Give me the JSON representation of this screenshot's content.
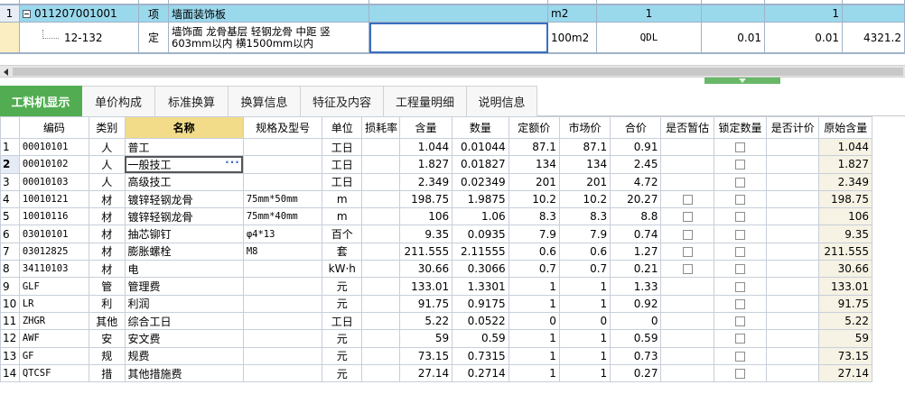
{
  "top_grid": {
    "rows": [
      {
        "rownum": "1",
        "code": "011207001001",
        "category": "项",
        "name": "墙面装饰板",
        "unit": "m2",
        "quantity_expr": "1",
        "quantity": "1"
      },
      {
        "rownum": "",
        "code": "12-132",
        "category": "定",
        "name": "墙饰面 龙骨基层 轻钢龙骨 中距 竖603mm以内 横1500mm以内",
        "unit": "100m2",
        "quantity_expr": "QDL",
        "qty_a": "0.01",
        "qty_b": "0.01",
        "price": "4321.2"
      }
    ]
  },
  "tabs": [
    {
      "label": "工料机显示",
      "active": true
    },
    {
      "label": "单价构成",
      "active": false
    },
    {
      "label": "标准换算",
      "active": false
    },
    {
      "label": "换算信息",
      "active": false
    },
    {
      "label": "特征及内容",
      "active": false
    },
    {
      "label": "工程量明细",
      "active": false
    },
    {
      "label": "说明信息",
      "active": false
    }
  ],
  "material_table": {
    "columns": [
      "",
      "编码",
      "类别",
      "名称",
      "规格及型号",
      "单位",
      "损耗率",
      "含量",
      "数量",
      "定额价",
      "市场价",
      "合价",
      "是否暂估",
      "锁定数量",
      "是否计价",
      "原始含量"
    ],
    "sorted_column": 3,
    "current_row": 1,
    "rows": [
      {
        "n": "1",
        "code": "00010101",
        "cat": "人",
        "name": "普工",
        "spec": "",
        "unit": "工日",
        "loss": "",
        "content": "1.044",
        "qty": "0.01044",
        "quota": "87.1",
        "market": "87.1",
        "total": "0.91",
        "est": false,
        "lock": true,
        "orig": "1.044"
      },
      {
        "n": "2",
        "code": "00010102",
        "cat": "人",
        "name": "一般技工",
        "spec": "",
        "unit": "工日",
        "loss": "",
        "content": "1.827",
        "qty": "0.01827",
        "quota": "134",
        "market": "134",
        "total": "2.45",
        "est": false,
        "lock": true,
        "orig": "1.827"
      },
      {
        "n": "3",
        "code": "00010103",
        "cat": "人",
        "name": "高级技工",
        "spec": "",
        "unit": "工日",
        "loss": "",
        "content": "2.349",
        "qty": "0.02349",
        "quota": "201",
        "market": "201",
        "total": "4.72",
        "est": false,
        "lock": true,
        "orig": "2.349"
      },
      {
        "n": "4",
        "code": "10010121",
        "cat": "材",
        "name": "镀锌轻钢龙骨",
        "spec": "75mm*50mm",
        "unit": "m",
        "loss": "",
        "content": "198.75",
        "qty": "1.9875",
        "quota": "10.2",
        "market": "10.2",
        "total": "20.27",
        "est": true,
        "lock": true,
        "orig": "198.75"
      },
      {
        "n": "5",
        "code": "10010116",
        "cat": "材",
        "name": "镀锌轻钢龙骨",
        "spec": "75mm*40mm",
        "unit": "m",
        "loss": "",
        "content": "106",
        "qty": "1.06",
        "quota": "8.3",
        "market": "8.3",
        "total": "8.8",
        "est": true,
        "lock": true,
        "orig": "106"
      },
      {
        "n": "6",
        "code": "03010101",
        "cat": "材",
        "name": "抽芯铆钉",
        "spec": "φ4*13",
        "unit": "百个",
        "loss": "",
        "content": "9.35",
        "qty": "0.0935",
        "quota": "7.9",
        "market": "7.9",
        "total": "0.74",
        "est": true,
        "lock": true,
        "orig": "9.35"
      },
      {
        "n": "7",
        "code": "03012825",
        "cat": "材",
        "name": "膨胀螺栓",
        "spec": "M8",
        "unit": "套",
        "loss": "",
        "content": "211.555",
        "qty": "2.11555",
        "quota": "0.6",
        "market": "0.6",
        "total": "1.27",
        "est": true,
        "lock": true,
        "orig": "211.555"
      },
      {
        "n": "8",
        "code": "34110103",
        "cat": "材",
        "name": "电",
        "spec": "",
        "unit": "kW·h",
        "loss": "",
        "content": "30.66",
        "qty": "0.3066",
        "quota": "0.7",
        "market": "0.7",
        "total": "0.21",
        "est": true,
        "lock": true,
        "orig": "30.66"
      },
      {
        "n": "9",
        "code": "GLF",
        "cat": "管",
        "name": "管理费",
        "spec": "",
        "unit": "元",
        "loss": "",
        "content": "133.01",
        "qty": "1.3301",
        "quota": "1",
        "market": "1",
        "total": "1.33",
        "est": false,
        "lock": true,
        "orig": "133.01"
      },
      {
        "n": "10",
        "code": "LR",
        "cat": "利",
        "name": "利润",
        "spec": "",
        "unit": "元",
        "loss": "",
        "content": "91.75",
        "qty": "0.9175",
        "quota": "1",
        "market": "1",
        "total": "0.92",
        "est": false,
        "lock": true,
        "orig": "91.75"
      },
      {
        "n": "11",
        "code": "ZHGR",
        "cat": "其他",
        "name": "综合工日",
        "spec": "",
        "unit": "工日",
        "loss": "",
        "content": "5.22",
        "qty": "0.0522",
        "quota": "0",
        "market": "0",
        "total": "0",
        "est": false,
        "lock": true,
        "orig": "5.22"
      },
      {
        "n": "12",
        "code": "AWF",
        "cat": "安",
        "name": "安文费",
        "spec": "",
        "unit": "元",
        "loss": "",
        "content": "59",
        "qty": "0.59",
        "quota": "1",
        "market": "1",
        "total": "0.59",
        "est": false,
        "lock": true,
        "orig": "59"
      },
      {
        "n": "13",
        "code": "GF",
        "cat": "规",
        "name": "规费",
        "spec": "",
        "unit": "元",
        "loss": "",
        "content": "73.15",
        "qty": "0.7315",
        "quota": "1",
        "market": "1",
        "total": "0.73",
        "est": false,
        "lock": true,
        "orig": "73.15"
      },
      {
        "n": "14",
        "code": "QTCSF",
        "cat": "措",
        "name": "其他措施费",
        "spec": "",
        "unit": "元",
        "loss": "",
        "content": "27.14",
        "qty": "0.2714",
        "quota": "1",
        "market": "1",
        "total": "0.27",
        "est": false,
        "lock": true,
        "orig": "27.14"
      }
    ]
  },
  "colors": {
    "selected_row": "#9ad8ec",
    "active_tab": "#52ad52",
    "sorted_header": "#f2dc8a",
    "row_marker": "#fbeec2"
  }
}
